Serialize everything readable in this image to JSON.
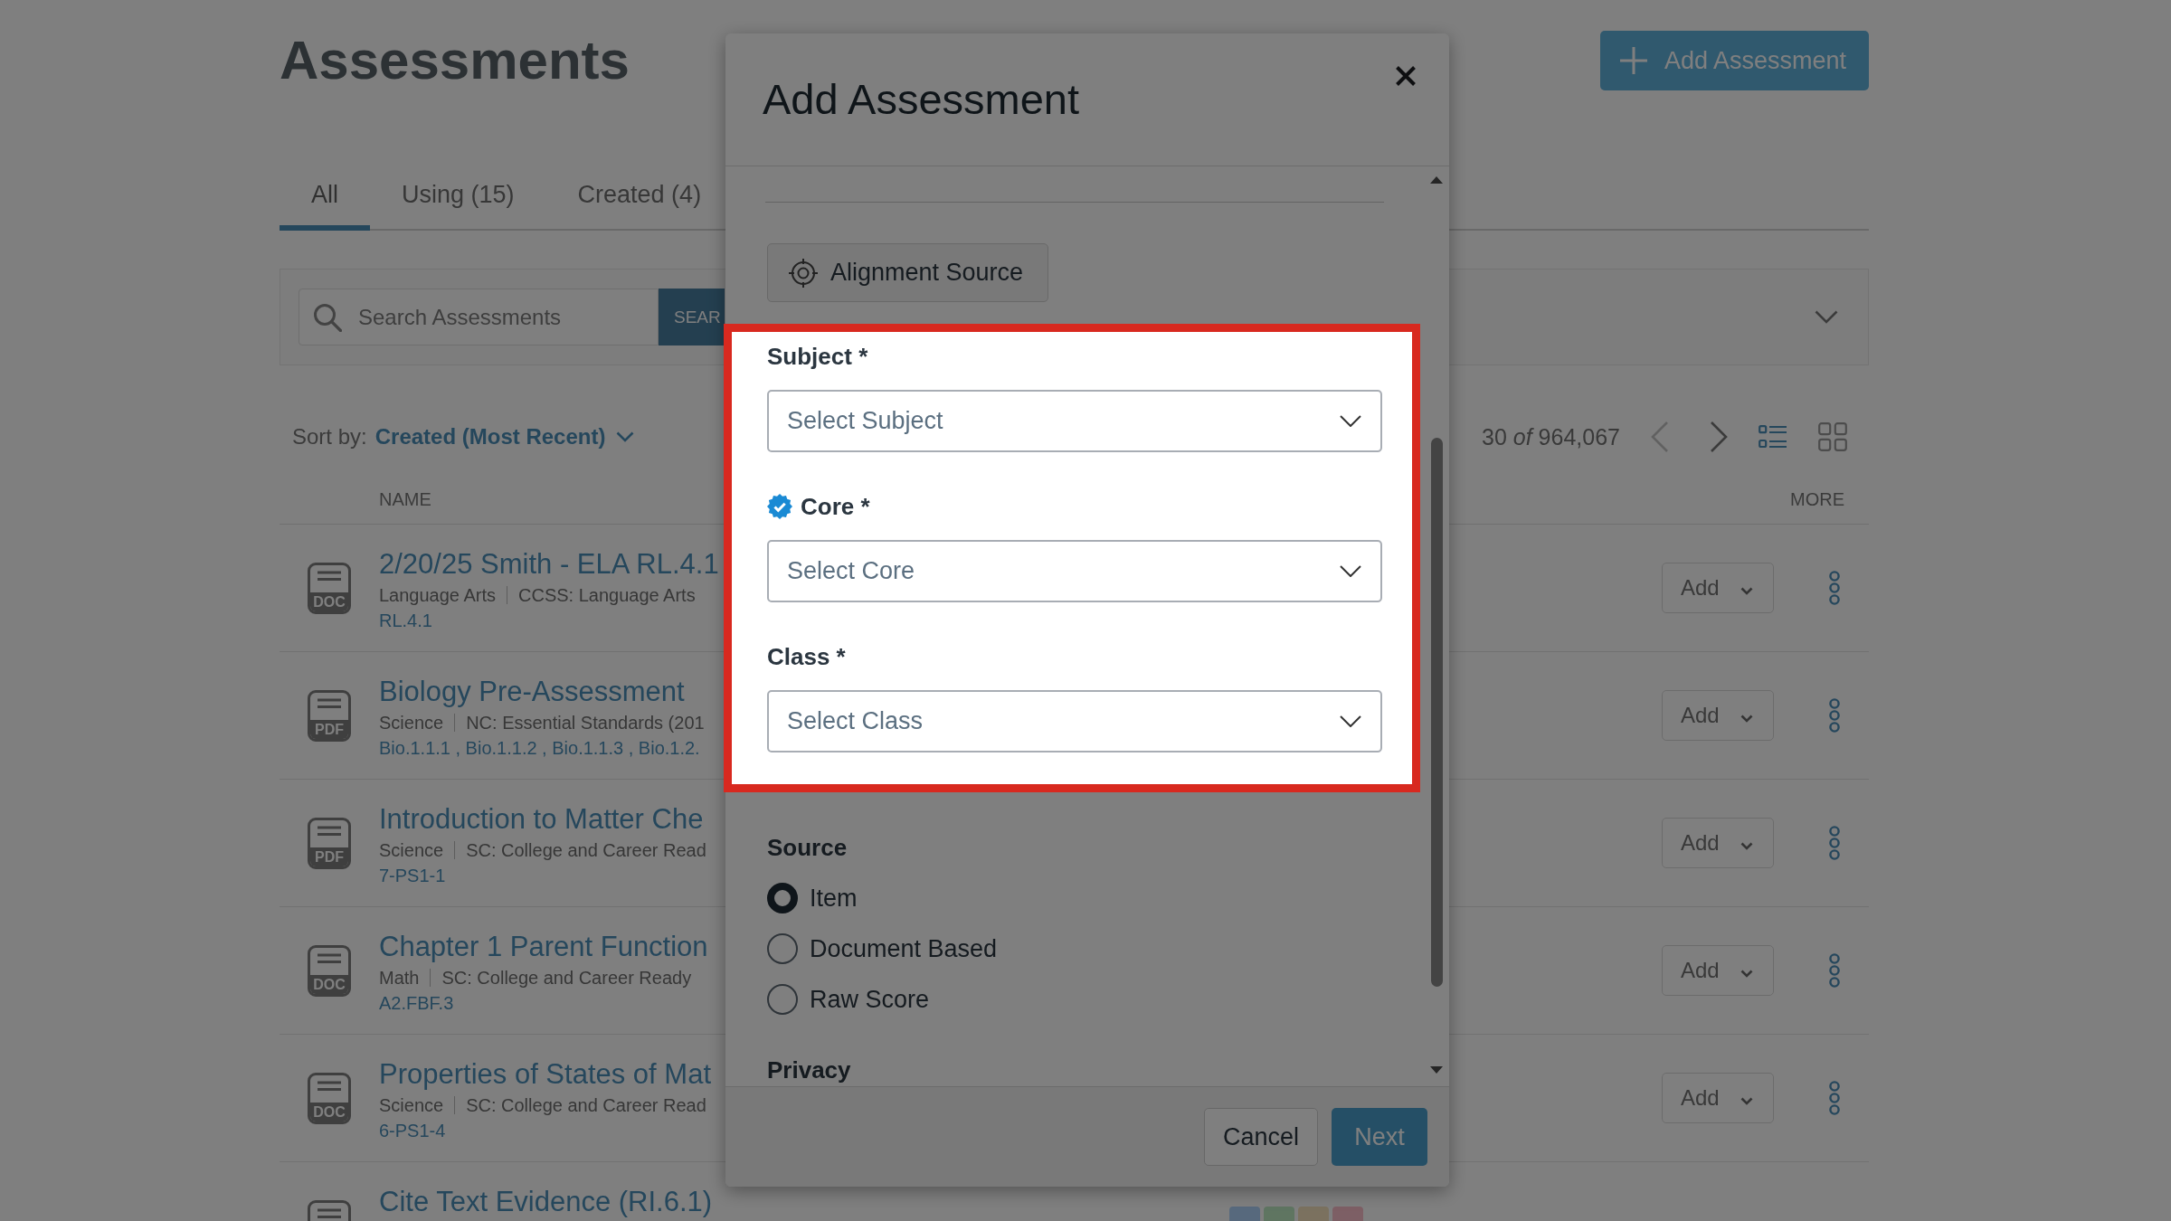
{
  "page": {
    "title": "Assessments",
    "add_button": "Add Assessment",
    "tabs": [
      {
        "label": "All",
        "selected": true
      },
      {
        "label": "Using (15)",
        "selected": false
      },
      {
        "label": "Created (4)",
        "selected": false
      }
    ],
    "search": {
      "placeholder": "Search Assessments",
      "button": "SEAR"
    },
    "sort": {
      "label": "Sort by:",
      "value": "Created (Most Recent)"
    },
    "pager": {
      "range": "30 *of* 964,067",
      "previous_disabled": true,
      "next_disabled": false
    },
    "views": [
      {
        "kind": "list",
        "selected": true
      },
      {
        "kind": "grid",
        "selected": false
      }
    ],
    "table": {
      "columns": [
        {
          "label": "NAME"
        },
        {
          "label": "MORE"
        }
      ],
      "rows": [
        {
          "file_type": "DOC",
          "title": "2/20/25 Smith - ELA RL.4.1",
          "subject": "Language Arts",
          "standard_set": "CCSS: Language Arts",
          "standards": "RL.4.1",
          "action": "Add"
        },
        {
          "file_type": "PDF",
          "title": "Biology Pre-Assessment",
          "subject": "Science",
          "standard_set": "NC: Essential Standards (201",
          "standards": "Bio.1.1.1 , Bio.1.1.2 , Bio.1.1.3 , Bio.1.2.",
          "action": "Add"
        },
        {
          "file_type": "PDF",
          "title": "Introduction to Matter Che",
          "subject": "Science",
          "standard_set": "SC: College and Career Read",
          "standards": "7-PS1-1",
          "action": "Add"
        },
        {
          "file_type": "DOC",
          "title": "Chapter 1 Parent Function",
          "subject": "Math",
          "standard_set": "SC: College and Career Ready",
          "standards": "A2.FBF.3",
          "action": "Add"
        },
        {
          "file_type": "DOC",
          "title": "Properties of States of Mat",
          "subject": "Science",
          "standard_set": "SC: College and Career Read",
          "standards": "6-PS1-4",
          "action": "Add"
        },
        {
          "title": "Cite Text Evidence (RI.6.1)",
          "tags": [
            {
              "color": "#586a7e"
            },
            {
              "color": "#5f7562"
            },
            {
              "color": "#7b7260"
            },
            {
              "color": "#7e5f65"
            }
          ]
        }
      ]
    }
  },
  "modal": {
    "title": "Add Assessment",
    "alignment_button": "Alignment Source",
    "fields": [
      {
        "label": "Subject *",
        "placeholder": "Select Subject",
        "verified": false
      },
      {
        "label": "Core *",
        "placeholder": "Select Core",
        "verified": true
      },
      {
        "label": "Class *",
        "placeholder": "Select Class",
        "verified": false
      }
    ],
    "source": {
      "label": "Source",
      "options": [
        {
          "label": "Item",
          "selected": true
        },
        {
          "label": "Document Based",
          "selected": false
        },
        {
          "label": "Raw Score",
          "selected": false
        }
      ]
    },
    "next_section": "Privacy",
    "buttons": [
      {
        "label": "Cancel",
        "kind": "secondary",
        "disabled": false
      },
      {
        "label": "Next",
        "kind": "primary",
        "disabled": true
      }
    ]
  },
  "tutorial": {
    "spotlight_on_fields": true
  }
}
